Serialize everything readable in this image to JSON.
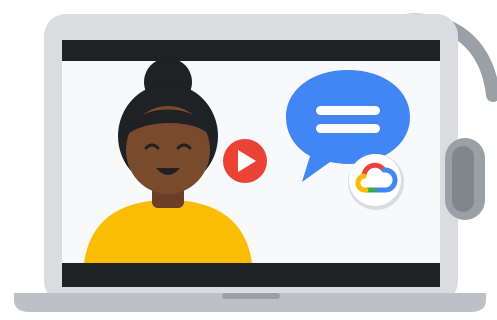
{
  "illustration": {
    "colors": {
      "laptop_frame": "#dadce0",
      "laptop_base": "#bdc1c6",
      "screen_bars": "#202124",
      "screen_background": "#f8f9fa",
      "skin": "#7a4a2e",
      "hair": "#202124",
      "shirt": "#fbbc04",
      "play_button": "#ea4335",
      "speech_bubble": "#4285f4",
      "headset": "#9aa0a6",
      "cloud_blue": "#4285f4",
      "cloud_red": "#ea4335",
      "cloud_yellow": "#fbbc04",
      "cloud_green": "#34a853"
    },
    "icons": [
      "laptop",
      "person-avatar",
      "play-icon",
      "speech-bubble-icon",
      "google-cloud-logo",
      "headset"
    ]
  }
}
